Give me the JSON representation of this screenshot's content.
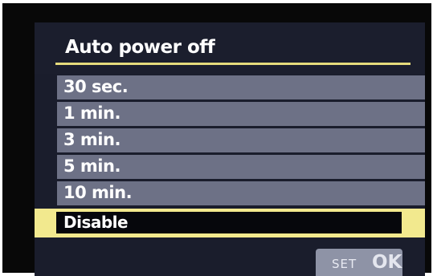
{
  "menu": {
    "title": "Auto power off",
    "items": [
      {
        "label": "30 sec."
      },
      {
        "label": "1 min."
      },
      {
        "label": "3 min."
      },
      {
        "label": "5 min."
      },
      {
        "label": "10 min."
      },
      {
        "label": "Disable"
      }
    ],
    "selected_index": 5
  },
  "footer": {
    "set_label": "SET",
    "ok_label": "OK"
  },
  "colors": {
    "screen_bg": "#1a1d2c",
    "item_bg": "#6d7186",
    "highlight": "#f2e98e",
    "title_rule": "#e5db7c"
  }
}
